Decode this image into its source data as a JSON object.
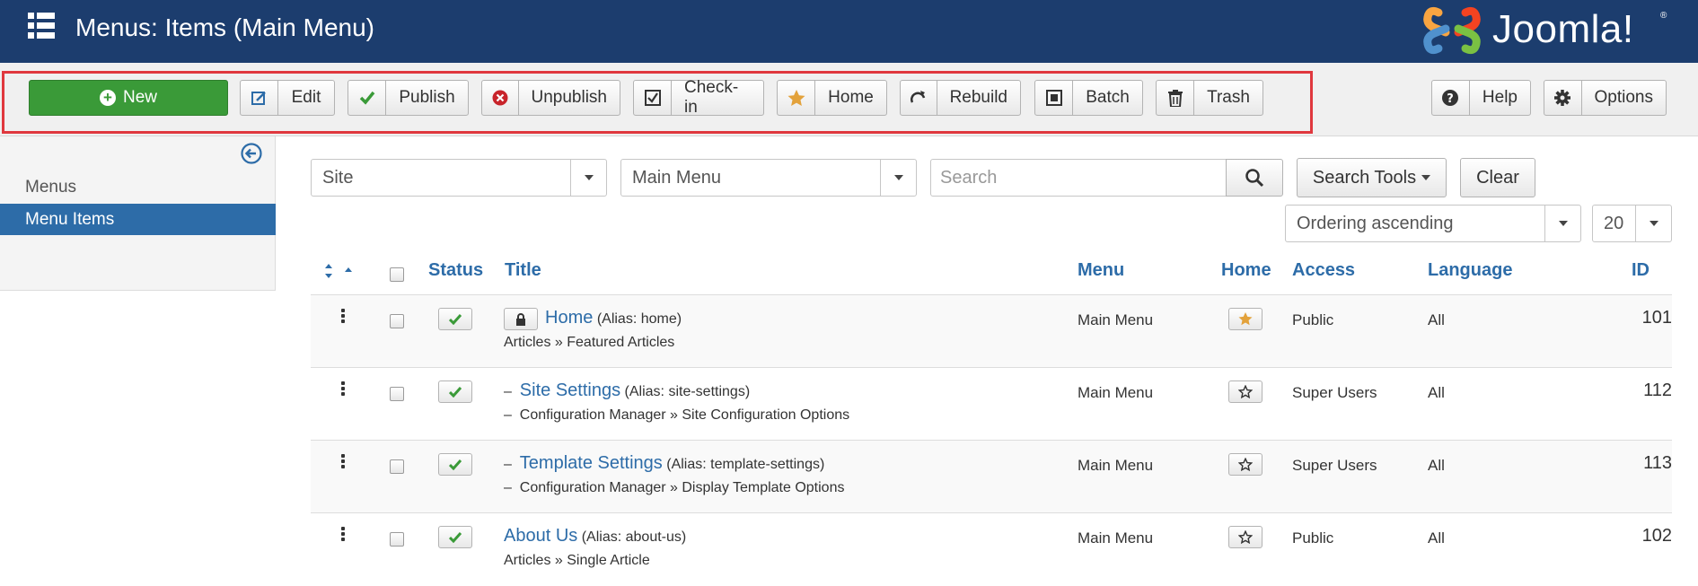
{
  "header": {
    "title": "Menus: Items (Main Menu)",
    "logo_text": "Joomla!",
    "logo_reg": "®"
  },
  "toolbar": {
    "new": "New",
    "edit": "Edit",
    "publish": "Publish",
    "unpublish": "Unpublish",
    "checkin": "Check-in",
    "home": "Home",
    "rebuild": "Rebuild",
    "batch": "Batch",
    "trash": "Trash",
    "help": "Help",
    "options": "Options"
  },
  "sidebar": {
    "items": [
      {
        "label": "Menus"
      },
      {
        "label": "Menu Items",
        "active": true
      }
    ]
  },
  "filters": {
    "client": "Site",
    "menu": "Main Menu",
    "search_placeholder": "Search",
    "search_tools": "Search Tools",
    "clear": "Clear",
    "ordering": "Ordering ascending",
    "limit": "20"
  },
  "table": {
    "headers": {
      "status": "Status",
      "title": "Title",
      "menu": "Menu",
      "home": "Home",
      "access": "Access",
      "language": "Language",
      "id": "ID"
    },
    "rows": [
      {
        "prefix": "",
        "title": "Home",
        "alias": "(Alias: home)",
        "sub_prefix": "",
        "subtitle": "Articles » Featured Articles",
        "menu": "Main Menu",
        "is_home": true,
        "access": "Public",
        "language": "All",
        "id": "101",
        "locked": true
      },
      {
        "prefix": "–",
        "title": "Site Settings",
        "alias": "(Alias: site-settings)",
        "sub_prefix": "–",
        "subtitle": "Configuration Manager » Site Configuration Options",
        "menu": "Main Menu",
        "is_home": false,
        "access": "Super Users",
        "language": "All",
        "id": "112",
        "locked": false
      },
      {
        "prefix": "–",
        "title": "Template Settings",
        "alias": "(Alias: template-settings)",
        "sub_prefix": "–",
        "subtitle": "Configuration Manager » Display Template Options",
        "menu": "Main Menu",
        "is_home": false,
        "access": "Super Users",
        "language": "All",
        "id": "113",
        "locked": false
      },
      {
        "prefix": "",
        "title": "About Us",
        "alias": "(Alias: about-us)",
        "sub_prefix": "",
        "subtitle": "Articles » Single Article",
        "menu": "Main Menu",
        "is_home": false,
        "access": "Public",
        "language": "All",
        "id": "102",
        "locked": false
      }
    ]
  },
  "colors": {
    "header_bg": "#1c3d6e",
    "accent": "#2d6ca8",
    "new_button": "#3a9a38",
    "highlight": "#e0383e",
    "home_star": "#e3a23b"
  }
}
